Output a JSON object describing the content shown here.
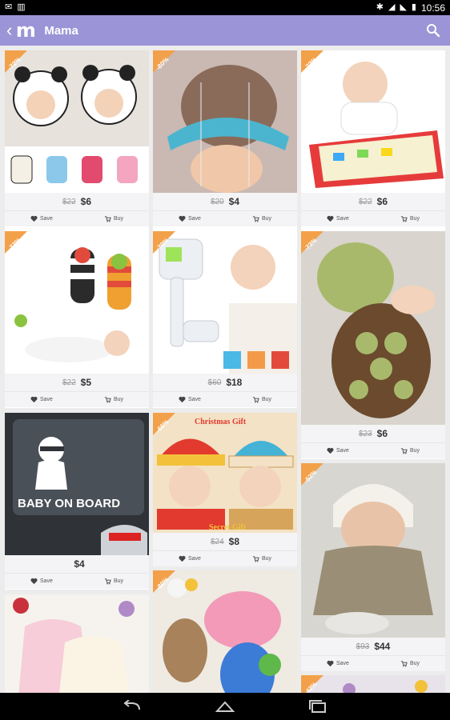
{
  "status_bar": {
    "time": "10:56"
  },
  "app_bar": {
    "logo_letter": "m",
    "title": "Mama"
  },
  "labels": {
    "save": "Save",
    "buy": "Buy"
  },
  "colors": {
    "app_bar": "#9b94d6",
    "discount": "#f2a14a"
  },
  "products": [
    {
      "discount": "-72%",
      "old_price": "$22",
      "price": "$6",
      "image": "baby-panda-hats"
    },
    {
      "discount": "-80%",
      "old_price": "$20",
      "price": "$4",
      "image": "baby-shower-cap"
    },
    {
      "discount": "-72%",
      "old_price": "$22",
      "price": "$6",
      "image": "baby-drawing-mat"
    },
    {
      "discount": "-77%",
      "old_price": "$22",
      "price": "$5",
      "image": "baby-rattle-socks"
    },
    {
      "discount": "-70%",
      "old_price": "$60",
      "price": "$18",
      "image": "infrared-thermometer"
    },
    {
      "discount": "-73%",
      "old_price": "$23",
      "price": "$6",
      "image": "crochet-turtle-outfit"
    },
    {
      "discount": "",
      "old_price": "",
      "price": "$4",
      "image": "baby-on-board-sticker"
    },
    {
      "discount": "-66%",
      "old_price": "$24",
      "price": "$8",
      "image": "christmas-knit-hat",
      "texts": [
        "Christmas Gift",
        "Secret Gift"
      ]
    },
    {
      "discount": "-52%",
      "old_price": "$93",
      "price": "$44",
      "image": "reborn-baby-doll"
    },
    {
      "discount": "",
      "old_price": "",
      "price": "",
      "image": "baby-fur-coat"
    },
    {
      "discount": "-80%",
      "old_price": "",
      "price": "",
      "image": "peppa-pig-plush"
    },
    {
      "discount": "-42%",
      "old_price": "",
      "price": "",
      "image": "partial-item"
    }
  ],
  "sticker_text": "BABY ON BOARD"
}
